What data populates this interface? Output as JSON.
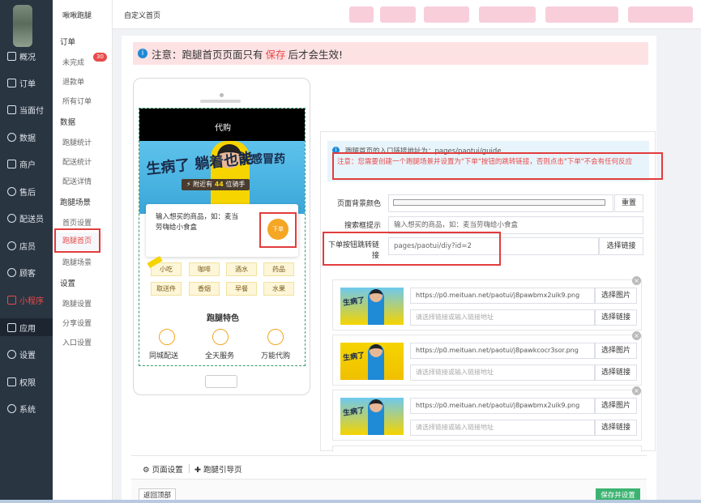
{
  "main_nav": [
    {
      "label": "概况"
    },
    {
      "label": "订单"
    },
    {
      "label": "当面付"
    },
    {
      "label": "数据"
    },
    {
      "label": "商户"
    },
    {
      "label": "售后"
    },
    {
      "label": "配送员"
    },
    {
      "label": "店员"
    },
    {
      "label": "顾客"
    },
    {
      "label": "小程序"
    },
    {
      "label": "应用"
    },
    {
      "label": "设置"
    },
    {
      "label": "权限"
    },
    {
      "label": "系统"
    }
  ],
  "sub_nav": {
    "brand": "啾啾跑腿",
    "groups": [
      {
        "title": "订单",
        "items": [
          "未完成",
          "退款单",
          "所有订单"
        ]
      },
      {
        "title": "数据",
        "items": [
          "跑腿统计",
          "配送统计",
          "配送详情"
        ]
      },
      {
        "title": "跑腿场景",
        "items": [
          "首页设置",
          "跑腿首页",
          "跑腿场景"
        ]
      },
      {
        "title": "设置",
        "items": [
          "跑腿设置",
          "分享设置",
          "入口设置"
        ]
      }
    ],
    "badge": "30"
  },
  "breadcrumb": "自定义首页",
  "notice": {
    "before": "注意：跑腿首页页面只有",
    "save": "保存",
    "after": "后才会生效!"
  },
  "phone": {
    "title": "代购",
    "banner_left": "生病了 躺着也能",
    "banner_right": "买感冒药",
    "nearby_before": "附近有",
    "nearby_count": "44",
    "nearby_after": "位骑手",
    "search_text": "输入想买的商品，如：麦当劳嗨给小食盒",
    "order_button": "下单",
    "categories": [
      "小吃",
      "咖啡",
      "酒水",
      "药品",
      "取送件",
      "香烟",
      "早餐",
      "水果"
    ],
    "features_title": "跑腿特色",
    "features": [
      "同城配送",
      "全天服务",
      "万能代购"
    ]
  },
  "settings": {
    "tip_line1": "跑腿首页的入口链接地址为：pages/paotui/guide",
    "tip_line2": "注意：您需要创建一个跑腿场景并设置为\"下单\"按钮的跳转链接，否则点击\"下单\"不会有任何反应",
    "bg_color_label": "页面背景颜色",
    "reset_button": "重置",
    "search_hint_label": "搜索框提示",
    "search_hint_value": "输入想买的商品，如：麦当劳嗨给小食盒",
    "order_link_label": "下单按钮跳转链接",
    "order_link_value": "pages/paotui/diy?id=2",
    "choose_link": "选择链接",
    "choose_image": "选择图片",
    "link_placeholder": "请选择链接或输入链接地址",
    "banners": [
      {
        "url": "https://p0.meituan.net/paotui/j8pawbmx2uik9.png"
      },
      {
        "url": "https://p0.meituan.net/paotui/j8pawkcocr3sor.png"
      },
      {
        "url": "https://p0.meituan.net/paotui/j8pawbmx2uik9.png"
      }
    ]
  },
  "tabs": [
    "页面设置",
    "跑腿引导页"
  ],
  "back_top": "返回顶部",
  "save_button": "保存并设置"
}
